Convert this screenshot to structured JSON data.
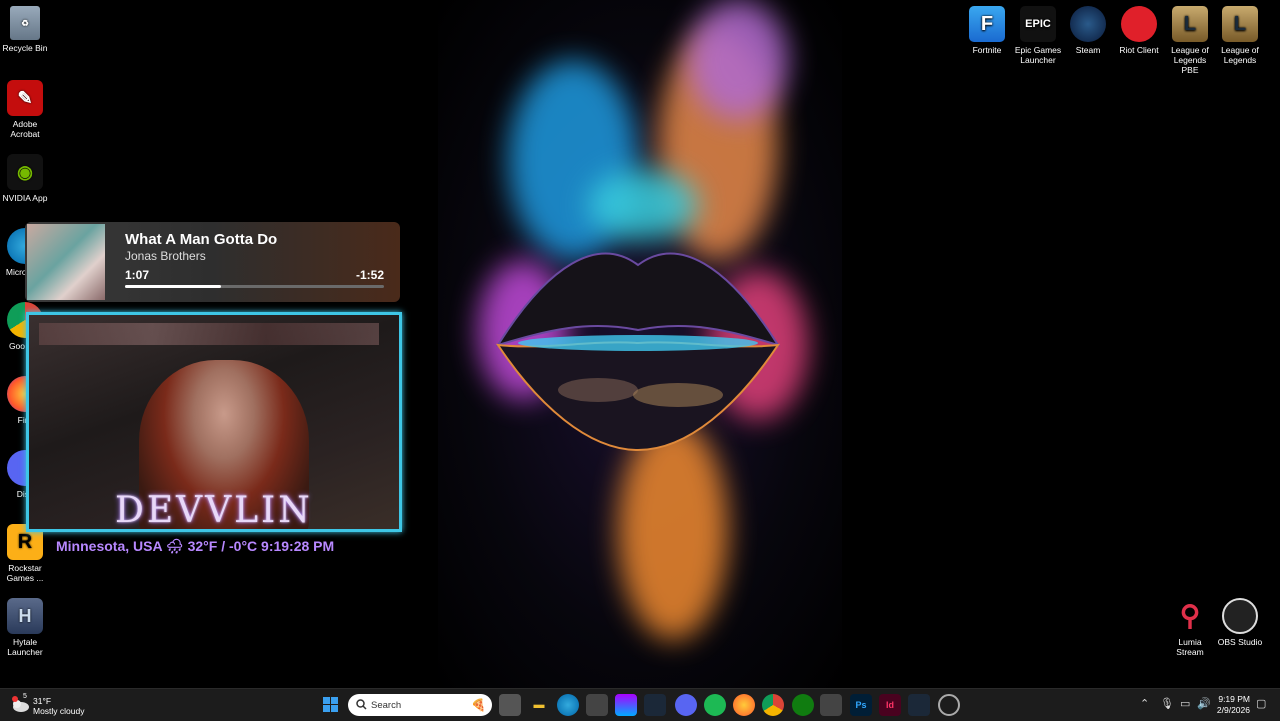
{
  "desktop_icons_left": [
    {
      "label": "Recycle Bin",
      "icon": "recycle-bin-icon"
    },
    {
      "label": "Adobe Acrobat",
      "icon": "adobe-acrobat-icon"
    },
    {
      "label": "NVIDIA App",
      "icon": "nvidia-icon"
    },
    {
      "label": "Micro Edg",
      "icon": "edge-icon"
    },
    {
      "label": "Goo Chr",
      "icon": "chrome-icon"
    },
    {
      "label": "Fire",
      "icon": "firefox-icon"
    },
    {
      "label": "Disc",
      "icon": "discord-icon"
    },
    {
      "label": "Rockstar Games ...",
      "icon": "rockstar-icon"
    },
    {
      "label": "Hytale Launcher",
      "icon": "hytale-icon"
    }
  ],
  "desktop_icons_right": [
    {
      "label": "Fortnite",
      "icon": "fortnite-icon",
      "glyph": "F"
    },
    {
      "label": "Epic Games Launcher",
      "icon": "epic-games-icon",
      "glyph": "EPIC"
    },
    {
      "label": "Steam",
      "icon": "steam-icon",
      "glyph": ""
    },
    {
      "label": "Riot Client",
      "icon": "riot-client-icon",
      "glyph": ""
    },
    {
      "label": "League of Legends PBE",
      "icon": "league-pbe-icon",
      "glyph": "L"
    },
    {
      "label": "League of Legends",
      "icon": "league-icon",
      "glyph": "L"
    }
  ],
  "desktop_icons_bottom_right": [
    {
      "label": "Lumia Stream",
      "icon": "lumia-stream-icon"
    },
    {
      "label": "OBS Studio",
      "icon": "obs-studio-icon"
    }
  ],
  "now_playing": {
    "title": "What A Man Gotta Do",
    "artist": "Jonas Brothers",
    "elapsed": "1:07",
    "remaining": "-1:52",
    "progress": 0.37
  },
  "overlay": {
    "brand": "DEVVLIN",
    "weather_line": "Minnesota, USA 🌧 32°F / -0°C  9:19:28 PM"
  },
  "taskbar": {
    "weather_temp": "31°F",
    "weather_desc": "Mostly cloudy",
    "weather_badge": "5",
    "search_placeholder": "Search",
    "time": "9:19 PM",
    "date": "2/9/2026"
  },
  "colors": {
    "taskbar_bg": "#1c1c1c",
    "cam_border": "#3ec6e6",
    "weather_text": "#b888ff"
  }
}
